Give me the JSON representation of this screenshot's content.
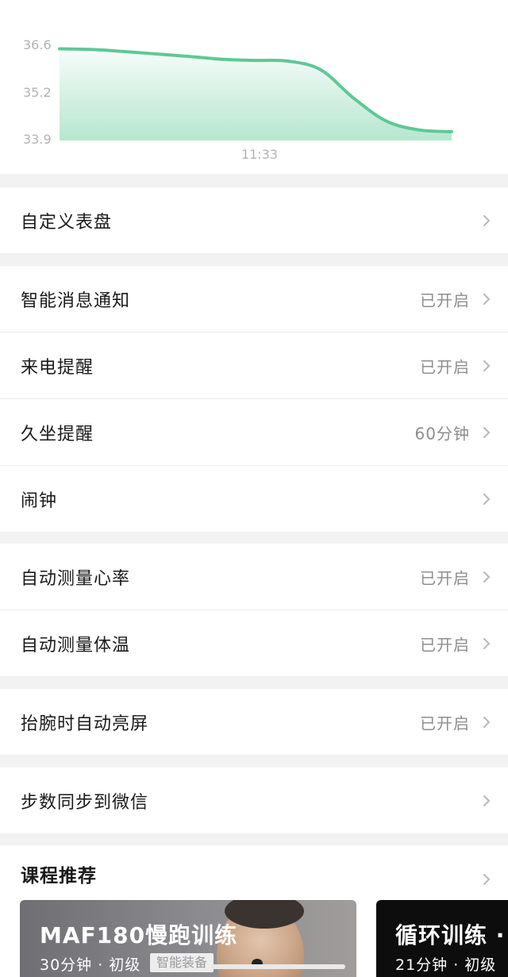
{
  "chart_data": {
    "type": "area",
    "y_ticks": [
      "36.6",
      "35.2",
      "33.9"
    ],
    "x_ticks": [
      "11:33"
    ],
    "ylim": [
      33.9,
      36.6
    ],
    "x": [
      0,
      1,
      2,
      3,
      4,
      5,
      6,
      7,
      8,
      9,
      10,
      11,
      12
    ],
    "values": [
      36.5,
      36.48,
      36.42,
      36.35,
      36.28,
      36.2,
      36.17,
      36.15,
      35.9,
      35.1,
      34.45,
      34.2,
      34.15
    ],
    "color": "#5ec895",
    "grid": false,
    "legend": "none"
  },
  "sections": [
    {
      "items": [
        {
          "label": "自定义表盘",
          "value": ""
        }
      ]
    },
    {
      "items": [
        {
          "label": "智能消息通知",
          "value": "已开启"
        },
        {
          "label": "来电提醒",
          "value": "已开启"
        },
        {
          "label": "久坐提醒",
          "value": "60分钟"
        },
        {
          "label": "闹钟",
          "value": ""
        }
      ]
    },
    {
      "items": [
        {
          "label": "自动测量心率",
          "value": "已开启"
        },
        {
          "label": "自动测量体温",
          "value": "已开启"
        }
      ]
    },
    {
      "items": [
        {
          "label": "抬腕时自动亮屏",
          "value": "已开启"
        }
      ]
    },
    {
      "items": [
        {
          "label": "步数同步到微信",
          "value": ""
        }
      ]
    }
  ],
  "courses": {
    "title": "课程推荐",
    "cards": [
      {
        "name": "MAF180慢跑训练",
        "meta": "30分钟 · 初级",
        "tag": "智能装备",
        "progress": 0.0
      },
      {
        "name": "循环训练 ·",
        "meta": "21分钟 · 初级"
      }
    ]
  },
  "icons": {
    "row_chevron": "chevron-right-icon"
  },
  "colors": {
    "accent": "#5ec895",
    "value_text": "#8e8e8e",
    "chevron": "#b8b8b8"
  }
}
